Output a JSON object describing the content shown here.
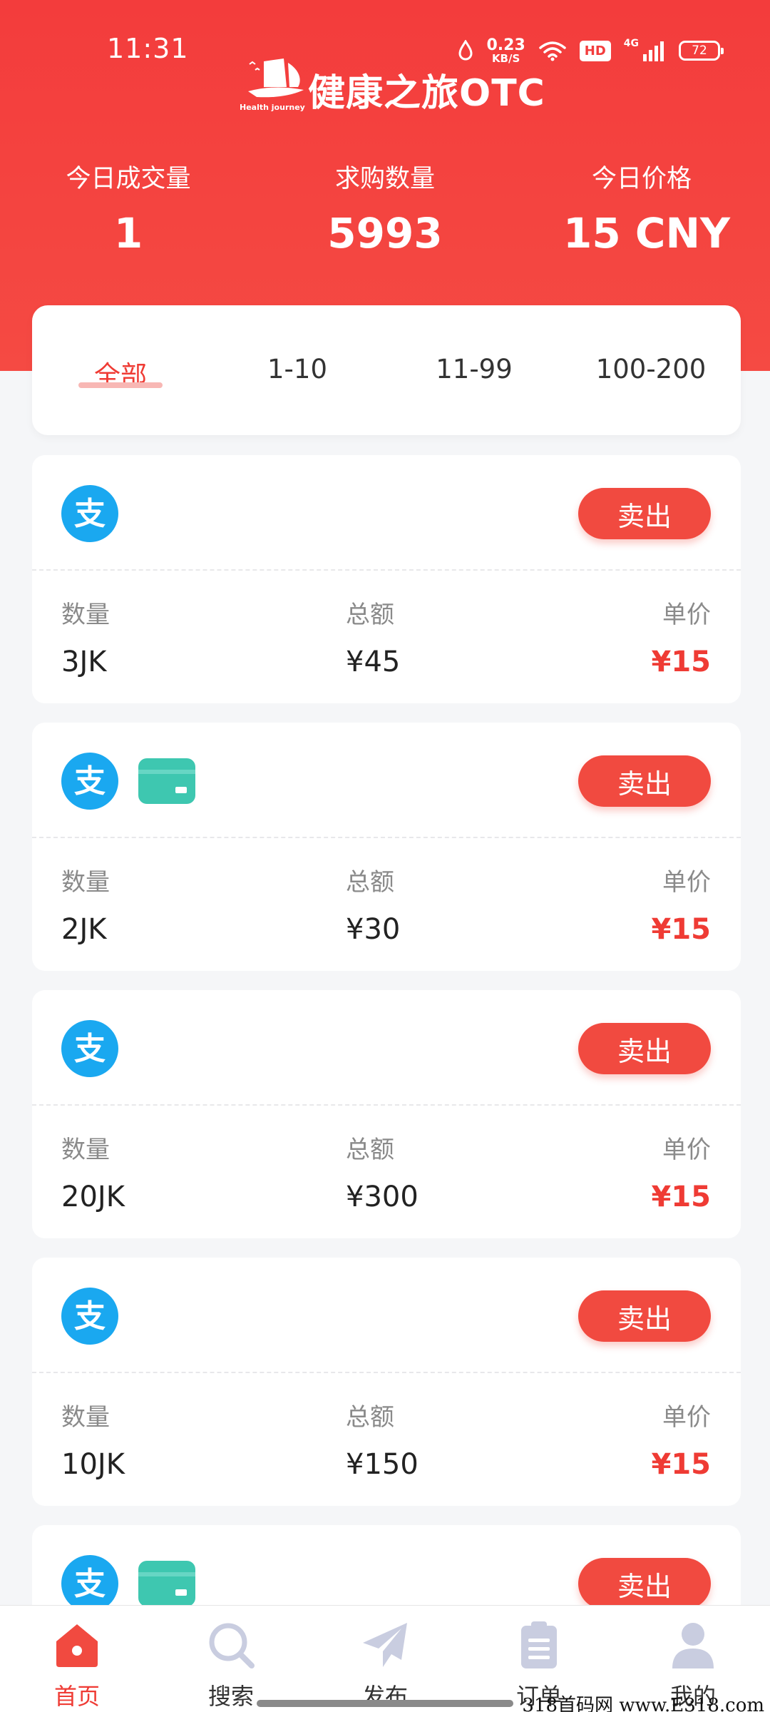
{
  "status_bar": {
    "time": "11:31",
    "net_speed_value": "0.23",
    "net_speed_unit": "KB/S",
    "hd": "HD",
    "signal": "4G",
    "battery": "72"
  },
  "brand": {
    "logo_tagline": "Health journey",
    "title": "健康之旅OTC"
  },
  "stats": [
    {
      "label": "今日成交量",
      "value": "1"
    },
    {
      "label": "求购数量",
      "value": "5993"
    },
    {
      "label": "今日价格",
      "value": "15 CNY"
    }
  ],
  "filter_tabs": [
    {
      "label": "全部",
      "active": true
    },
    {
      "label": "1-10",
      "active": false
    },
    {
      "label": "11-99",
      "active": false
    },
    {
      "label": "100-200",
      "active": false
    }
  ],
  "labels": {
    "quantity": "数量",
    "total": "总额",
    "unit_price": "单价",
    "sell_button": "卖出"
  },
  "orders": [
    {
      "pay_methods": [
        "alipay-icon"
      ],
      "quantity": "3JK",
      "total": "¥45",
      "unit_price": "¥15"
    },
    {
      "pay_methods": [
        "alipay-icon",
        "bank-card-icon"
      ],
      "quantity": "2JK",
      "total": "¥30",
      "unit_price": "¥15"
    },
    {
      "pay_methods": [
        "alipay-icon"
      ],
      "quantity": "20JK",
      "total": "¥300",
      "unit_price": "¥15"
    },
    {
      "pay_methods": [
        "alipay-icon"
      ],
      "quantity": "10JK",
      "total": "¥150",
      "unit_price": "¥15"
    },
    {
      "pay_methods": [
        "alipay-icon",
        "bank-card-icon"
      ],
      "quantity": "",
      "total": "",
      "unit_price": ""
    }
  ],
  "bottom_nav": [
    {
      "label": "首页",
      "icon": "home-icon",
      "active": true
    },
    {
      "label": "搜索",
      "icon": "search-icon",
      "active": false
    },
    {
      "label": "发布",
      "icon": "send-icon",
      "active": false
    },
    {
      "label": "订单",
      "icon": "clipboard-icon",
      "active": false
    },
    {
      "label": "我的",
      "icon": "user-icon",
      "active": false
    }
  ],
  "watermark": "318首码网 www.E318.com",
  "colors": {
    "brand_red": "#f33c3c",
    "price_red": "#ef3b34",
    "alipay_blue": "#1aa8f0",
    "card_teal": "#3ec7b0",
    "nav_inactive": "#c9cde0"
  }
}
